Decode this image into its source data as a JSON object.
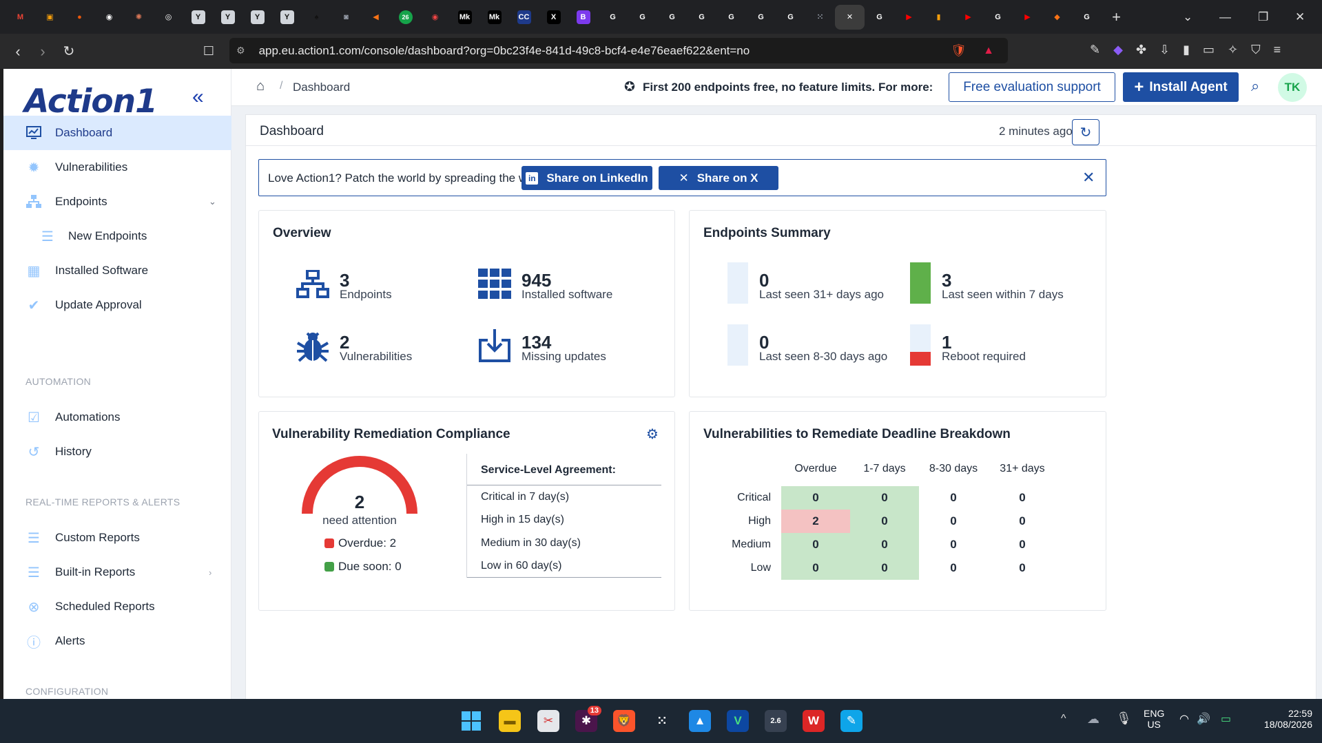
{
  "browser": {
    "url": "app.eu.action1.com/console/dashboard?org=0bc23f4e-841d-49c8-bcf4-e4e76eaef622&ent=no",
    "tabs": [
      {
        "icon": "gmail-icon",
        "glyph": "M",
        "color": "#ea4335"
      },
      {
        "icon": "orange-square-icon",
        "glyph": "▣",
        "color": "#f59e0b"
      },
      {
        "icon": "orange-circle-icon",
        "glyph": "●",
        "color": "#ea580c"
      },
      {
        "icon": "github-icon",
        "glyph": "◉",
        "color": "#ffffff"
      },
      {
        "icon": "claude-icon",
        "glyph": "✺",
        "color": "#d97757"
      },
      {
        "icon": "chatgpt-icon",
        "glyph": "◎",
        "color": "#ffffff"
      },
      {
        "icon": "y-icon",
        "glyph": "Y",
        "color": "#9ca3af"
      },
      {
        "icon": "y-icon",
        "glyph": "Y",
        "color": "#9ca3af"
      },
      {
        "icon": "y-icon",
        "glyph": "Y",
        "color": "#9ca3af"
      },
      {
        "icon": "y-icon",
        "glyph": "Y",
        "color": "#9ca3af"
      },
      {
        "icon": "drop-icon",
        "glyph": "♠",
        "color": "#111111"
      },
      {
        "icon": "gray-app-icon",
        "glyph": "◙",
        "color": "#9ca3af"
      },
      {
        "icon": "orange-arrow-icon",
        "glyph": "◀",
        "color": "#f97316"
      },
      {
        "icon": "green-badge-icon",
        "glyph": "26",
        "color": "#16a34a"
      },
      {
        "icon": "record-icon",
        "glyph": "◉",
        "color": "#ef4444"
      },
      {
        "icon": "mk-icon",
        "glyph": "Mk",
        "color": "#000000"
      },
      {
        "icon": "mk-icon",
        "glyph": "Mk",
        "color": "#000000"
      },
      {
        "icon": "cc-icon",
        "glyph": "CC",
        "color": "#1e3a8a"
      },
      {
        "icon": "x-icon",
        "glyph": "X",
        "color": "#000000"
      },
      {
        "icon": "b-icon",
        "glyph": "B",
        "color": "#7c3aed"
      },
      {
        "icon": "google-icon",
        "glyph": "G",
        "color": "#ffffff"
      },
      {
        "icon": "google-icon",
        "glyph": "G",
        "color": "#ffffff"
      },
      {
        "icon": "google-icon",
        "glyph": "G",
        "color": "#ffffff"
      },
      {
        "icon": "google-icon",
        "glyph": "G",
        "color": "#ffffff"
      },
      {
        "icon": "google-icon",
        "glyph": "G",
        "color": "#ffffff"
      },
      {
        "icon": "google-icon",
        "glyph": "G",
        "color": "#ffffff"
      },
      {
        "icon": "google-icon",
        "glyph": "G",
        "color": "#ffffff"
      },
      {
        "icon": "dots-icon",
        "glyph": "⁙",
        "color": "#9ca3af"
      },
      {
        "icon": "close-tab-icon",
        "glyph": "✕",
        "color": "#ffffff",
        "active": true
      },
      {
        "icon": "google-icon",
        "glyph": "G",
        "color": "#ffffff"
      },
      {
        "icon": "youtube-icon",
        "glyph": "▶",
        "color": "#ff0000"
      },
      {
        "icon": "meet-icon",
        "glyph": "▮",
        "color": "#f59e0b"
      },
      {
        "icon": "youtube-icon",
        "glyph": "▶",
        "color": "#ff0000"
      },
      {
        "icon": "google-icon",
        "glyph": "G",
        "color": "#ffffff"
      },
      {
        "icon": "youtube-icon",
        "glyph": "▶",
        "color": "#ff0000"
      },
      {
        "icon": "diamond-icon",
        "glyph": "◆",
        "color": "#f97316"
      },
      {
        "icon": "google-icon",
        "glyph": "G",
        "color": "#ffffff"
      }
    ],
    "new_tab": "+"
  },
  "sidebar": {
    "logo": "Action1",
    "items": [
      {
        "label": "Dashboard",
        "icon": "dashboard-icon",
        "active": true
      },
      {
        "label": "Vulnerabilities",
        "icon": "bug-icon"
      },
      {
        "label": "Endpoints",
        "icon": "network-icon",
        "expand": true
      },
      {
        "label": "New Endpoints",
        "icon": "layers-icon",
        "indent": true
      },
      {
        "label": "Installed Software",
        "icon": "grid-icon"
      },
      {
        "label": "Update Approval",
        "icon": "check-shield-icon"
      }
    ],
    "automation_header": "AUTOMATION",
    "automation_items": [
      {
        "label": "Automations",
        "icon": "calendar-check-icon"
      },
      {
        "label": "History",
        "icon": "history-icon"
      }
    ],
    "reports_header": "REAL-TIME REPORTS & ALERTS",
    "report_items": [
      {
        "label": "Custom Reports",
        "icon": "layers-icon"
      },
      {
        "label": "Built-in Reports",
        "icon": "layers-icon",
        "chevron": true
      },
      {
        "label": "Scheduled Reports",
        "icon": "clock-icon"
      },
      {
        "label": "Alerts",
        "icon": "alert-icon"
      }
    ],
    "config_header": "CONFIGURATION"
  },
  "topbar": {
    "breadcrumb": "Dashboard",
    "promo": "First 200 endpoints free, no feature limits. For more:",
    "eval_button": "Free evaluation support",
    "install_button": "Install Agent",
    "avatar": "TK"
  },
  "dashboard": {
    "title": "Dashboard",
    "updated": "2 minutes ago",
    "share_text": "Love Action1? Patch the world by spreading the word:",
    "share_linkedin": "Share on LinkedIn",
    "share_x": "Share on X"
  },
  "overview": {
    "title": "Overview",
    "stats": [
      {
        "value": "3",
        "label": "Endpoints",
        "icon": "network-icon"
      },
      {
        "value": "945",
        "label": "Installed software",
        "icon": "grid-icon"
      },
      {
        "value": "2",
        "label": "Vulnerabilities",
        "icon": "bug-icon"
      },
      {
        "value": "134",
        "label": "Missing updates",
        "icon": "download-icon"
      }
    ]
  },
  "endpoints_summary": {
    "title": "Endpoints Summary",
    "stats": [
      {
        "value": "0",
        "label": "Last seen 31+ days ago",
        "fill": 0,
        "color": "#43a047"
      },
      {
        "value": "3",
        "label": "Last seen within 7 days",
        "fill": 1,
        "color": "#5fb04a"
      },
      {
        "value": "0",
        "label": "Last seen 8-30 days ago",
        "fill": 0,
        "color": "#43a047"
      },
      {
        "value": "1",
        "label": "Reboot required",
        "fill": 0.33,
        "color": "#e53935"
      }
    ]
  },
  "compliance": {
    "title": "Vulnerability Remediation Compliance",
    "gauge_value": "2",
    "gauge_label": "need attention",
    "overdue": "Overdue: 2",
    "due_soon": "Due soon: 0",
    "overdue_color": "#e53935",
    "due_soon_color": "#43a047",
    "sla_header": "Service-Level Agreement:",
    "sla_rows": [
      "Critical in 7 day(s)",
      "High in 15 day(s)",
      "Medium in 30 day(s)",
      "Low in 60 day(s)"
    ]
  },
  "breakdown": {
    "title": "Vulnerabilities to Remediate Deadline Breakdown",
    "columns": [
      "Overdue",
      "1-7 days",
      "8-30 days",
      "31+ days"
    ],
    "rows": [
      {
        "label": "Critical",
        "values": [
          "0",
          "0",
          "0",
          "0"
        ]
      },
      {
        "label": "High",
        "values": [
          "2",
          "0",
          "0",
          "0"
        ]
      },
      {
        "label": "Medium",
        "values": [
          "0",
          "0",
          "0",
          "0"
        ]
      },
      {
        "label": "Low",
        "values": [
          "0",
          "0",
          "0",
          "0"
        ]
      }
    ]
  },
  "taskbar": {
    "lang": "ENG",
    "region": "US",
    "time": "22:59",
    "date": "18/08/2026",
    "slack_badge": "13"
  }
}
